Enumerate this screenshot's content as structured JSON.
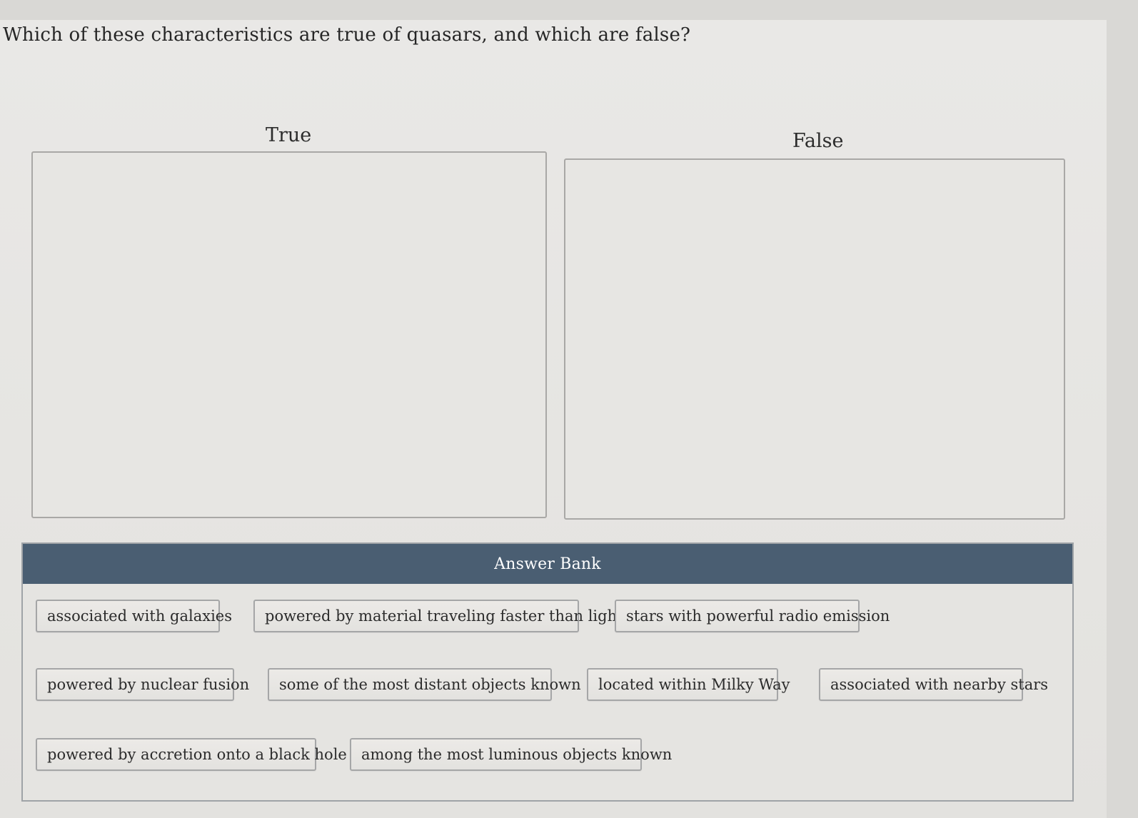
{
  "question": "Which of these characteristics are true of quasars, and which are false?",
  "zones": {
    "true_label": "True",
    "false_label": "False"
  },
  "answer_bank": {
    "title": "Answer Bank",
    "items": [
      "associated with galaxies",
      "powered by material traveling faster than light",
      "stars with powerful radio emission",
      "powered by nuclear fusion",
      "some of the most distant objects known",
      "located within Milky Way",
      "associated with nearby stars",
      "powered by accretion onto a black hole",
      "among the most luminous objects known"
    ]
  },
  "colors": {
    "bank_header": "#4a5e72",
    "page_background": "#e8e7e4"
  }
}
